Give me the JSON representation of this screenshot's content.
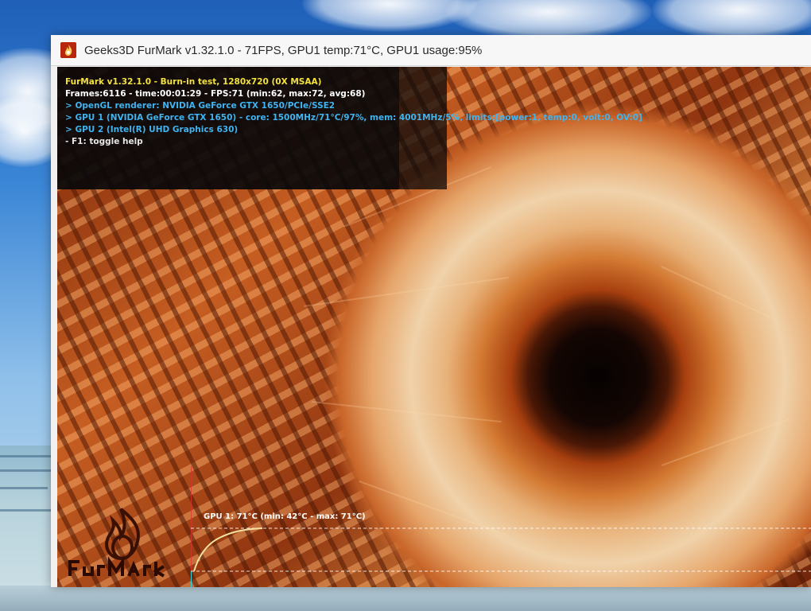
{
  "window": {
    "title": "Geeks3D FurMark v1.32.1.0 - 71FPS, GPU1 temp:71°C, GPU1 usage:95%"
  },
  "hud": {
    "lines": [
      "FurMark v1.32.1.0 - Burn-in test, 1280x720 (0X MSAA)",
      "Frames:6116 - time:00:01:29 - FPS:71 (min:62, max:72, avg:68)",
      "> OpenGL renderer: NVIDIA GeForce GTX 1650/PCIe/SSE2",
      "> GPU 1 (NVIDIA GeForce GTX 1650) - core: 1500MHz/71°C/97%, mem: 4001MHz/5%, limits:[power:1, temp:0, volt:0, OV:0]",
      "> GPU 2 (Intel(R) UHD Graphics 630)",
      "- F1: toggle help"
    ],
    "colors": [
      "#f2e23a",
      "#ffffff",
      "#3fb4f0",
      "#3fb4f0",
      "#3fb4f0",
      "#e6e6e6"
    ]
  },
  "temp_graph": {
    "label": "GPU 1: 71°C (min: 42°C - max: 71°C)"
  },
  "icons": {
    "app": "furmark-flame-icon",
    "logo": "furmark-logo"
  }
}
